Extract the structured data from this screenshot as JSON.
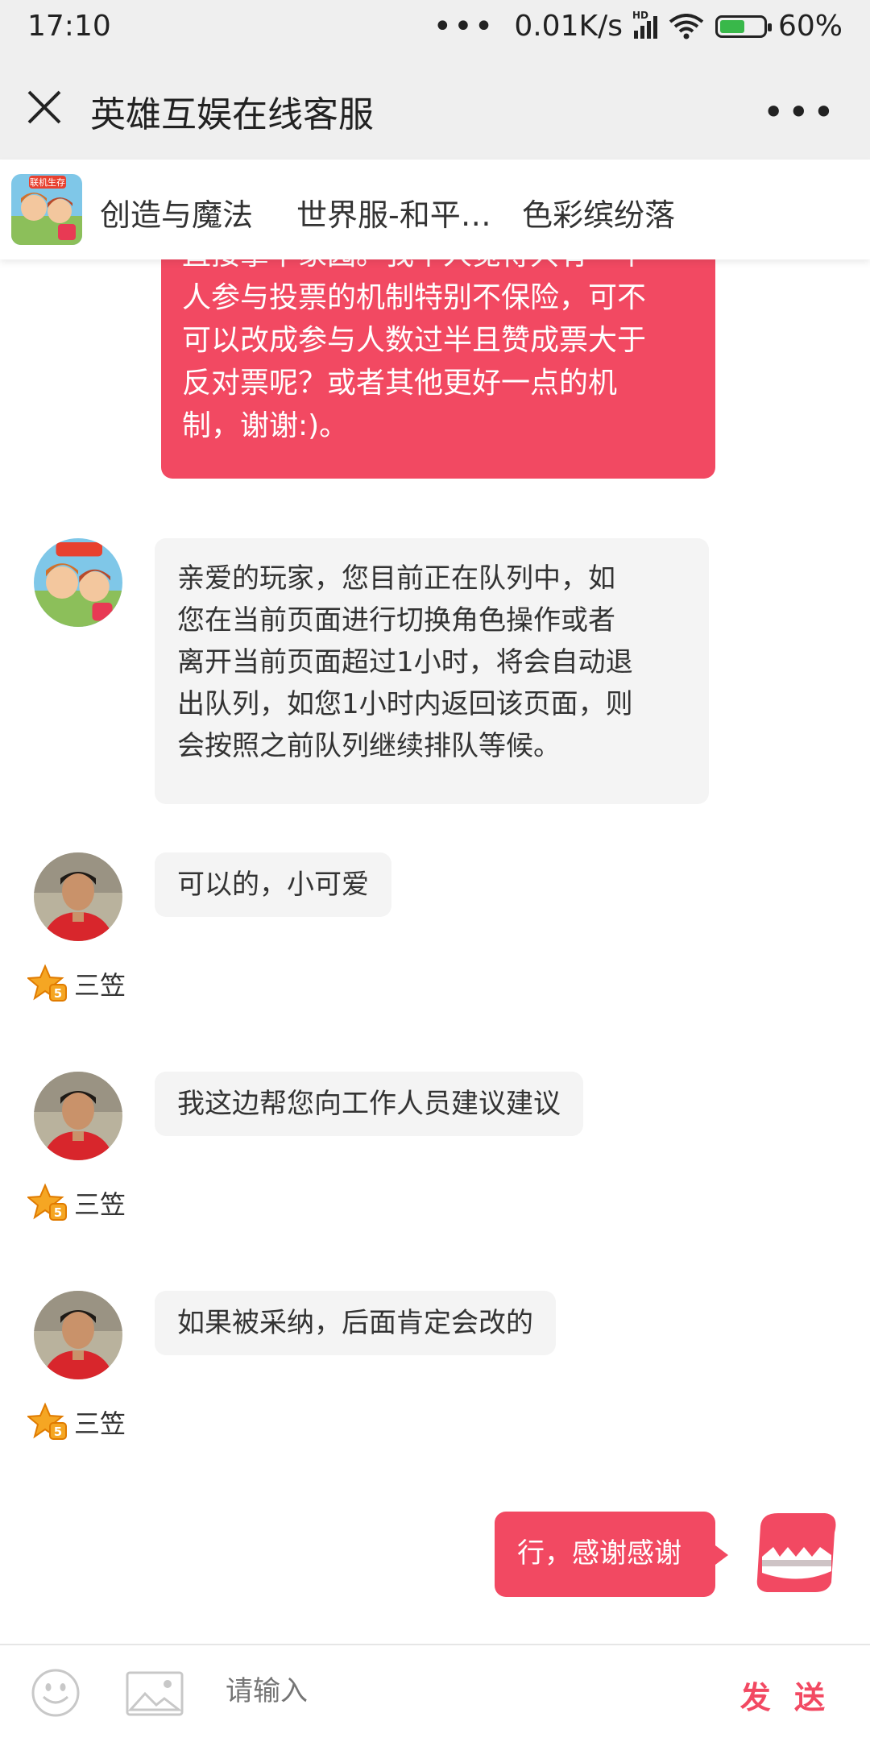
{
  "status_bar": {
    "time": "17:10",
    "dots": "•••",
    "net_speed": "0.01K/s",
    "signal_label": "HD",
    "battery": "60%"
  },
  "title_bar": {
    "title": "英雄互娱在线客服",
    "more": "•••"
  },
  "game_tabs": {
    "logo_text": "联机生存",
    "tabs": [
      "创造与魔法",
      "世界服-和平…",
      "色彩缤纷落"
    ]
  },
  "messages": [
    {
      "from": "user",
      "lines": [
        "直接拿下家园。我个人觉得只有一个",
        "人参与投票的机制特别不保险，可不",
        "可以改成参与人数过半且赞成票大于",
        "反对票呢？或者其他更好一点的机",
        "制，谢谢:)。"
      ]
    },
    {
      "from": "system",
      "lines": [
        "亲爱的玩家，您目前正在队列中，如",
        "您在当前页面进行切换角色操作或者",
        "离开当前页面超过1小时，将会自动退",
        "出队列，如您1小时内返回该页面，则",
        "会按照之前队列继续排队等候。"
      ]
    },
    {
      "from": "agent",
      "text": "可以的，小可爱",
      "agent_name": "三笠",
      "badge": "5"
    },
    {
      "from": "agent",
      "text": "我这边帮您向工作人员建议建议",
      "agent_name": "三笠",
      "badge": "5"
    },
    {
      "from": "agent",
      "text": "如果被采纳，后面肯定会改的",
      "agent_name": "三笠",
      "badge": "5"
    },
    {
      "from": "user",
      "text": "行，感谢感谢"
    }
  ],
  "input_bar": {
    "placeholder": "请输入",
    "send_label": "发 送"
  },
  "colors": {
    "accent": "#f24962",
    "agent_bubble": "#f4f4f4",
    "header_bg": "#efefef"
  }
}
